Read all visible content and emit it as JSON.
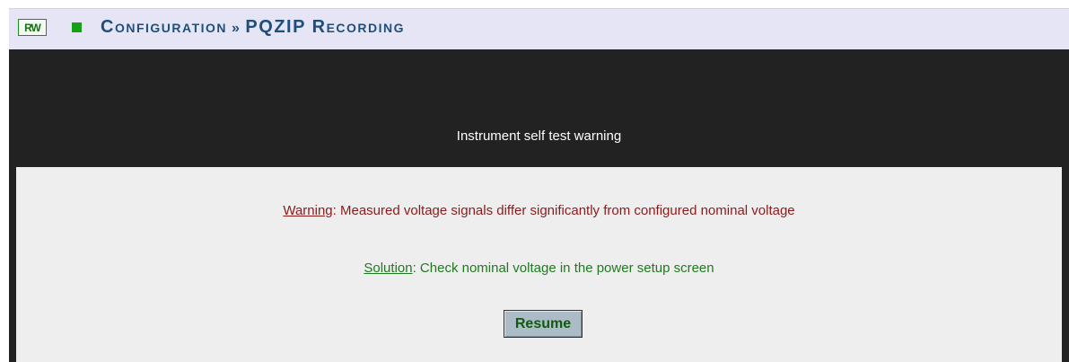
{
  "header": {
    "rw_badge": "RW",
    "breadcrumb_section": "Configuration",
    "breadcrumb_separator": "»",
    "breadcrumb_page": "PQZIP Recording",
    "colors": {
      "header_bg": "#e5e5f6",
      "breadcrumb_text": "#1e4f7c",
      "indicator": "#16a016"
    }
  },
  "dialog": {
    "title": "Instrument self test warning",
    "warning_label": "Warning",
    "warning_text": ": Measured voltage signals differ significantly from configured nominal voltage",
    "solution_label": "Solution",
    "solution_text": ": Check nominal voltage in the power setup screen",
    "resume_label": "Resume",
    "colors": {
      "panel_bg": "#222222",
      "body_bg": "#eeeeee",
      "warning": "#8b1b1b",
      "solution": "#1f7a1f"
    }
  },
  "icons": {
    "status_indicator": "green-square-icon"
  }
}
